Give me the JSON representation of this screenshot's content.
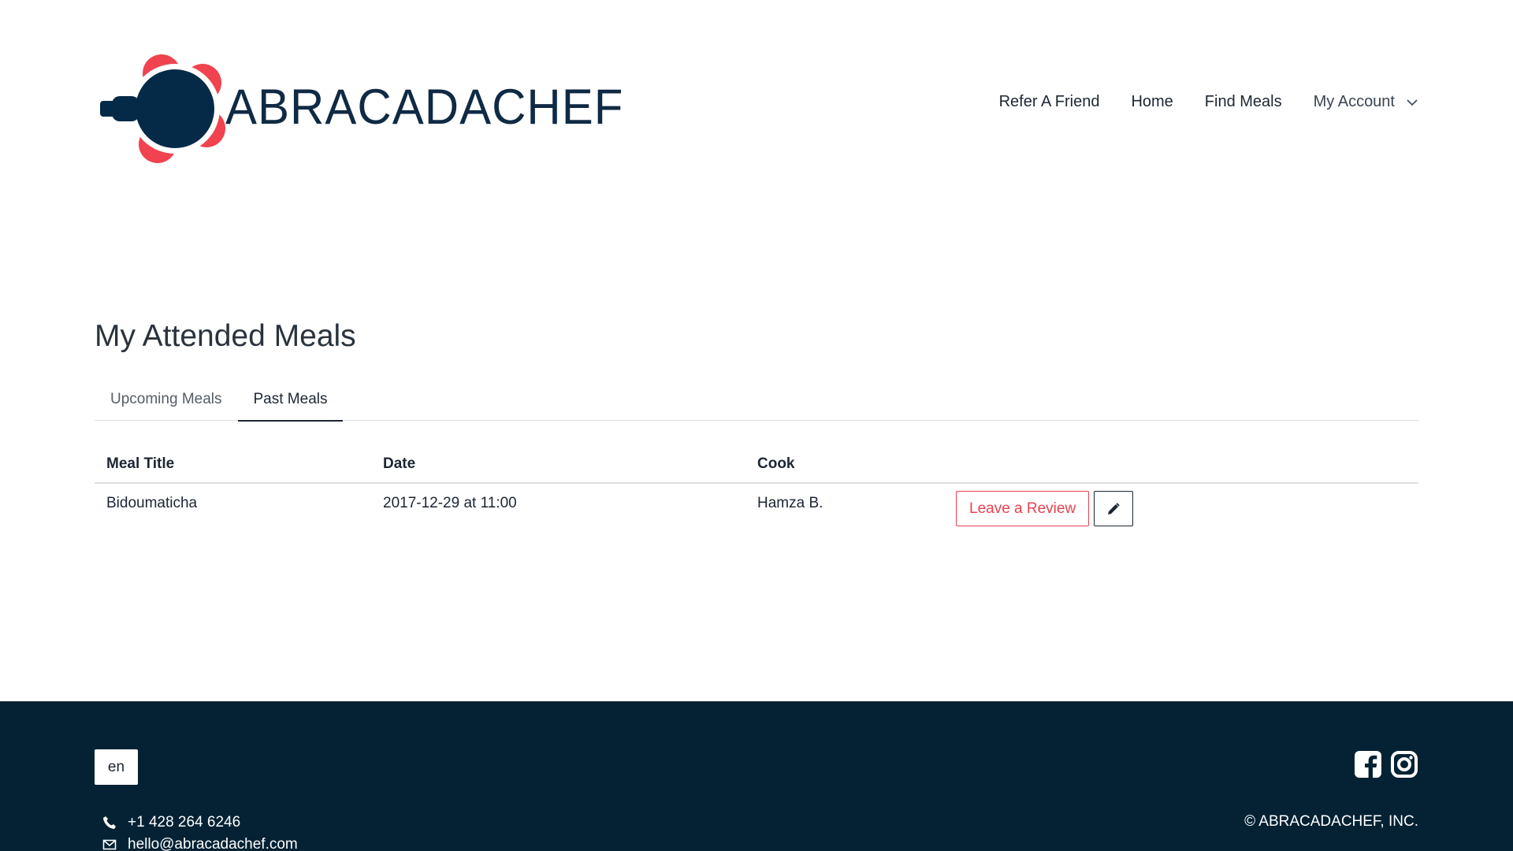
{
  "brand": {
    "name": "ABRACADACHEF"
  },
  "nav": {
    "items": [
      "Refer A Friend",
      "Home",
      "Find Meals"
    ],
    "account_label": "My Account"
  },
  "page": {
    "title": "My Attended Meals"
  },
  "tabs": [
    {
      "label": "Upcoming Meals",
      "active": false
    },
    {
      "label": "Past Meals",
      "active": true
    }
  ],
  "table": {
    "headers": [
      "Meal Title",
      "Date",
      "Cook"
    ],
    "rows": [
      {
        "meal_title": "Bidoumaticha",
        "date": "2017-12-29 at 11:00",
        "cook": "Hamza B.",
        "review_label": "Leave a Review"
      }
    ]
  },
  "footer": {
    "language": "en",
    "phone": "+1 428 264 6246",
    "email": "hello@abracadachef.com",
    "copyright": "© ABRACADACHEF, INC.",
    "socials": [
      "facebook-icon",
      "instagram-icon"
    ]
  },
  "colors": {
    "brand_navy": "#0f2a44",
    "brand_red": "#f0434f",
    "footer_bg": "#042234",
    "review_red": "#e8424f"
  }
}
